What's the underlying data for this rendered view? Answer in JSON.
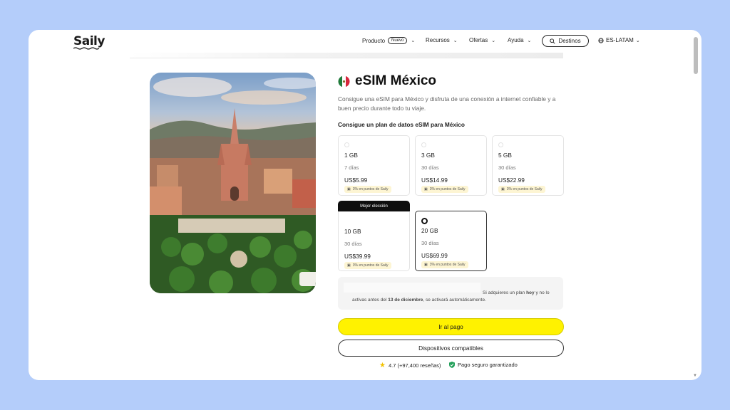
{
  "header": {
    "logo": "Saily",
    "nav": [
      {
        "label": "Producto",
        "badge": "Nuevo"
      },
      {
        "label": "Recursos"
      },
      {
        "label": "Ofertas"
      },
      {
        "label": "Ayuda"
      }
    ],
    "destinations_button": "Destinos",
    "language": "ES-LATAM"
  },
  "product": {
    "flag": "mexico-flag-icon",
    "title": "eSIM México",
    "description": "Consigue una eSIM para México y disfruta de una conexión a internet confiable y a buen precio durante todo tu viaje.",
    "plans_heading": "Consigue un plan de datos eSIM para México",
    "best_choice_label": "Mejor elección",
    "plans": [
      {
        "data": "1 GB",
        "duration": "7 días",
        "price": "US$5.99",
        "points": "3% en puntos de Saily",
        "selected": false
      },
      {
        "data": "3 GB",
        "duration": "30 días",
        "price": "US$14.99",
        "points": "3% en puntos de Saily",
        "selected": false
      },
      {
        "data": "5 GB",
        "duration": "30 días",
        "price": "US$22.99",
        "points": "3% en puntos de Saily",
        "selected": false
      },
      {
        "data": "10 GB",
        "duration": "30 días",
        "price": "US$39.99",
        "points": "3% en puntos de Saily",
        "selected": false
      },
      {
        "data": "20 GB",
        "duration": "30 días",
        "price": "US$69.99",
        "points": "3% en puntos de Saily",
        "selected": true
      }
    ]
  },
  "notice": {
    "part1": "Si adquieres un plan ",
    "bold1": "hoy",
    "part2": " y no lo",
    "part3": "activas antes del ",
    "bold2": "13 de diciembre",
    "part4": ", se activará automáticamente."
  },
  "actions": {
    "pay": "Ir al pago",
    "devices": "Dispositivos compatibles"
  },
  "trust": {
    "rating": "4.7 (+97,400 reseñas)",
    "secure": "Pago seguro garantizado"
  },
  "colors": {
    "background": "#b4cdfa",
    "accent_yellow": "#fff200",
    "points_badge": "#fdf5d3"
  }
}
